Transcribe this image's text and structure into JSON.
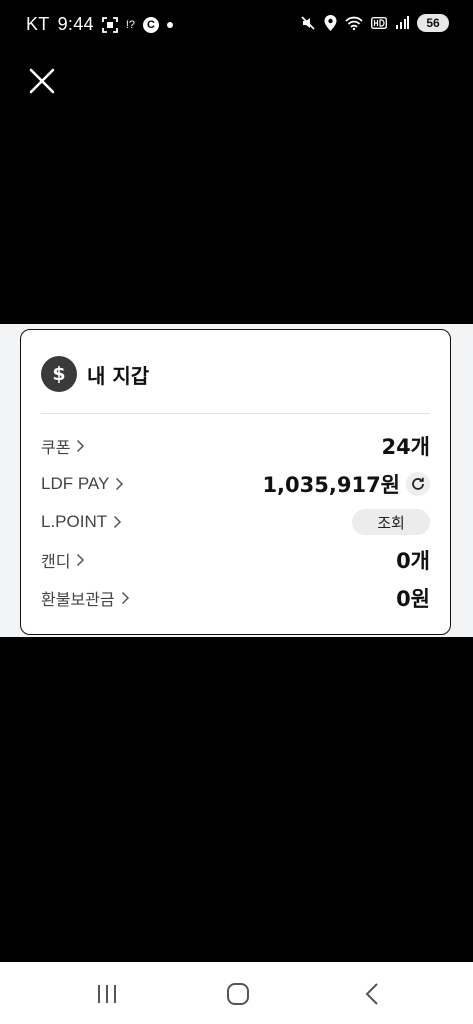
{
  "status_bar": {
    "carrier": "KT",
    "time": "9:44",
    "alert_icon_text": "!?",
    "c_badge": "C",
    "battery": "56"
  },
  "wallet": {
    "title": "내 지갑",
    "rows": [
      {
        "label": "쿠폰",
        "value": "24개"
      },
      {
        "label": "LDF PAY",
        "value": "1,035,917원"
      },
      {
        "label": "L.POINT",
        "button": "조회"
      },
      {
        "label": "캔디",
        "value": "0개"
      },
      {
        "label": "환불보관금",
        "value": "0원"
      }
    ]
  }
}
